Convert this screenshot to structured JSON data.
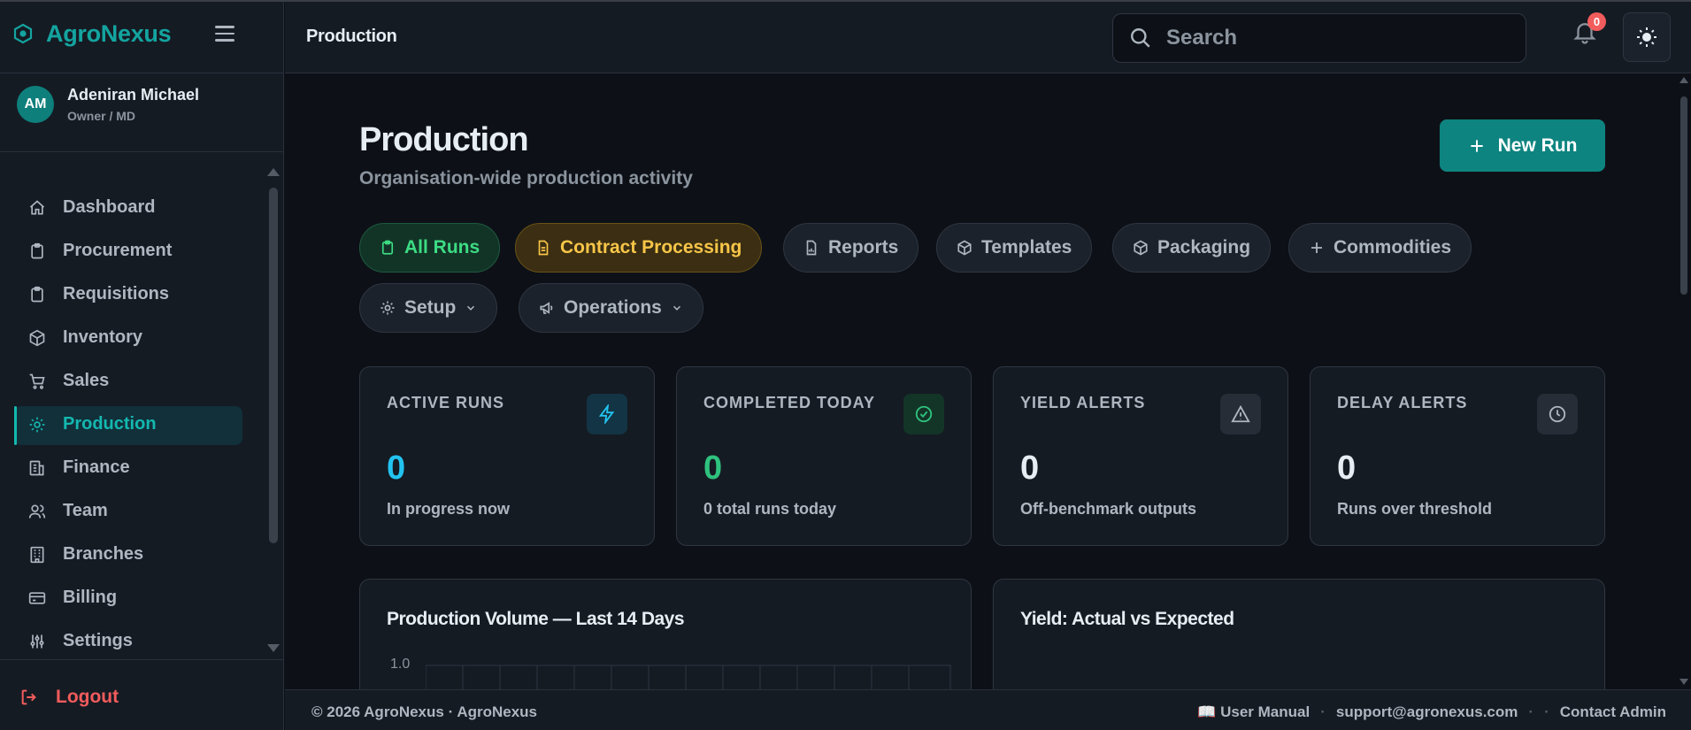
{
  "app": {
    "brand": "AgroNexus"
  },
  "user": {
    "initials": "AM",
    "name": "Adeniran Michael",
    "role": "Owner / MD"
  },
  "sidebar": {
    "items": [
      {
        "label": "Dashboard",
        "icon": "home-icon"
      },
      {
        "label": "Procurement",
        "icon": "clipboard-icon"
      },
      {
        "label": "Requisitions",
        "icon": "clipboard-icon"
      },
      {
        "label": "Inventory",
        "icon": "box-icon"
      },
      {
        "label": "Sales",
        "icon": "cart-icon"
      },
      {
        "label": "Production",
        "icon": "gear-icon",
        "active": true
      },
      {
        "label": "Finance",
        "icon": "finance-icon"
      },
      {
        "label": "Team",
        "icon": "users-icon"
      },
      {
        "label": "Branches",
        "icon": "building-icon"
      },
      {
        "label": "Billing",
        "icon": "card-icon"
      },
      {
        "label": "Settings",
        "icon": "sliders-icon"
      }
    ],
    "logout": "Logout"
  },
  "header": {
    "title": "Production",
    "search_placeholder": "Search",
    "notification_count": "0"
  },
  "page": {
    "title": "Production",
    "subtitle": "Organisation-wide production activity",
    "new_run": "New Run"
  },
  "tabs": [
    {
      "label": "All Runs"
    },
    {
      "label": "Contract Processing"
    },
    {
      "label": "Reports"
    },
    {
      "label": "Templates"
    },
    {
      "label": "Packaging"
    },
    {
      "label": "Commodities"
    },
    {
      "label": "Setup"
    },
    {
      "label": "Operations"
    }
  ],
  "stats": [
    {
      "label": "ACTIVE RUNS",
      "value": "0",
      "sub": "In progress now",
      "color": "#22c3f0"
    },
    {
      "label": "COMPLETED TODAY",
      "value": "0",
      "sub": "0 total runs today",
      "color": "#2ec27e"
    },
    {
      "label": "YIELD ALERTS",
      "value": "0",
      "sub": "Off-benchmark outputs",
      "color": "#e6edf3"
    },
    {
      "label": "DELAY ALERTS",
      "value": "0",
      "sub": "Runs over threshold",
      "color": "#e6edf3"
    }
  ],
  "panels": {
    "volume": {
      "title": "Production Volume — Last 14 Days",
      "y_top_tick": "1.0"
    },
    "yield": {
      "title": "Yield: Actual vs Expected"
    }
  },
  "footer": {
    "copyright": "© 2026 AgroNexus · AgroNexus",
    "manual": "📖 User Manual",
    "support": "support@agronexus.com",
    "contact": "Contact Admin"
  },
  "colors": {
    "accent": "#0e8480",
    "danger": "#f25c5c"
  }
}
